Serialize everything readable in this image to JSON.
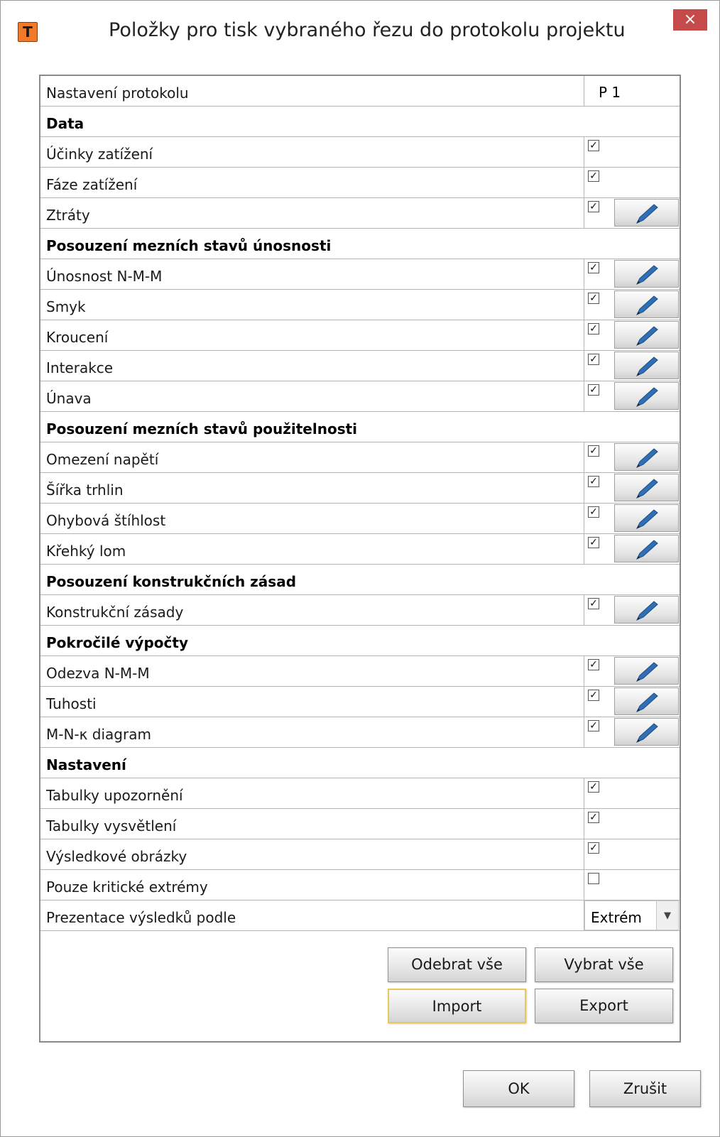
{
  "window": {
    "title": "Položky pro tisk vybraného řezu do protokolu projektu",
    "close_glyph": "×",
    "icon_letter": "T"
  },
  "settings_row": {
    "label": "Nastavení protokolu",
    "value": "P 1"
  },
  "groups": [
    {
      "header": "Data",
      "items": [
        {
          "label": "Účinky zatížení",
          "checked": true,
          "editable": false
        },
        {
          "label": "Fáze zatížení",
          "checked": true,
          "editable": false
        },
        {
          "label": "Ztráty",
          "checked": true,
          "editable": true
        }
      ]
    },
    {
      "header": "Posouzení mezních stavů únosnosti",
      "items": [
        {
          "label": "Únosnost N-M-M",
          "checked": true,
          "editable": true
        },
        {
          "label": "Smyk",
          "checked": true,
          "editable": true
        },
        {
          "label": "Kroucení",
          "checked": true,
          "editable": true
        },
        {
          "label": "Interakce",
          "checked": true,
          "editable": true
        },
        {
          "label": "Únava",
          "checked": true,
          "editable": true
        }
      ]
    },
    {
      "header": "Posouzení mezních stavů použitelnosti",
      "items": [
        {
          "label": "Omezení napětí",
          "checked": true,
          "editable": true
        },
        {
          "label": "Šířka trhlin",
          "checked": true,
          "editable": true
        },
        {
          "label": "Ohybová štíhlost",
          "checked": true,
          "editable": true
        },
        {
          "label": "Křehký lom",
          "checked": true,
          "editable": true
        }
      ]
    },
    {
      "header": "Posouzení konstrukčních zásad",
      "items": [
        {
          "label": "Konstrukční zásady",
          "checked": true,
          "editable": true
        }
      ]
    },
    {
      "header": "Pokročilé výpočty",
      "items": [
        {
          "label": "Odezva N-M-M",
          "checked": true,
          "editable": true
        },
        {
          "label": "Tuhosti",
          "checked": true,
          "editable": true
        },
        {
          "label": "M-N-κ diagram",
          "checked": true,
          "editable": true
        }
      ]
    },
    {
      "header": "Nastavení",
      "items": [
        {
          "label": "Tabulky upozornění",
          "checked": true,
          "editable": false
        },
        {
          "label": "Tabulky vysvětlení",
          "checked": true,
          "editable": false
        },
        {
          "label": "Výsledkové obrázky",
          "checked": true,
          "editable": false
        },
        {
          "label": "Pouze kritické extrémy",
          "checked": false,
          "editable": false
        }
      ]
    }
  ],
  "presentation": {
    "label": "Prezentace výsledků podle",
    "selected": "Extrém"
  },
  "buttons": {
    "remove_all": "Odebrat vše",
    "select_all": "Vybrat vše",
    "import": "Import",
    "export": "Export",
    "ok": "OK",
    "cancel": "Zrušit"
  },
  "colors": {
    "close_bg": "#c74a4a",
    "icon_bg": "#f07a2a",
    "pencil": "#2f6fb5",
    "focus": "#e8c85a"
  },
  "icons": {
    "edit": "pencil-icon",
    "dropdown": "chevron-down-icon"
  }
}
